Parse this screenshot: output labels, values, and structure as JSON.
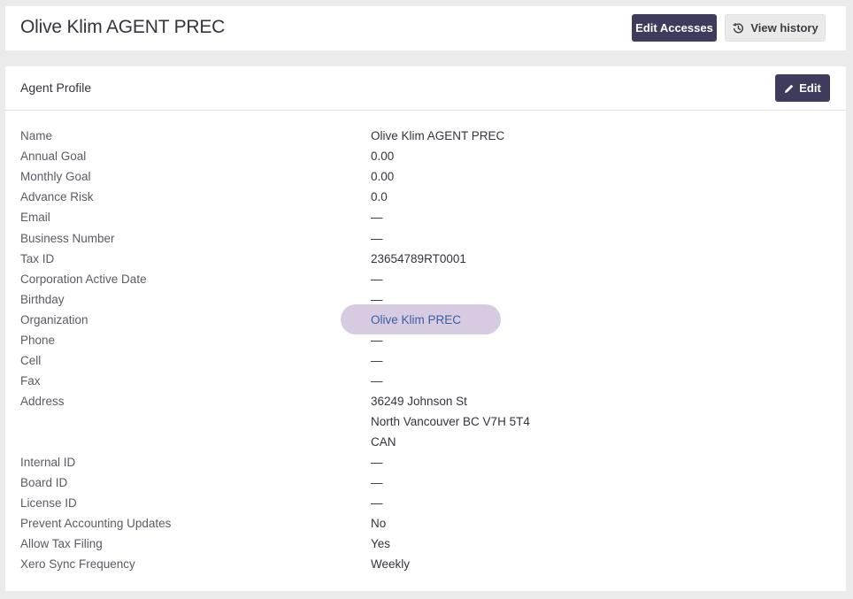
{
  "page": {
    "title": "Olive Klim AGENT PREC",
    "edit_accesses_label": "Edit Accesses",
    "view_history_label": "View history"
  },
  "profile": {
    "section_title": "Agent Profile",
    "edit_label": "Edit",
    "fields": {
      "name": {
        "label": "Name",
        "value": "Olive Klim AGENT PREC"
      },
      "annual_goal": {
        "label": "Annual Goal",
        "value": "0.00"
      },
      "monthly_goal": {
        "label": "Monthly Goal",
        "value": "0.00"
      },
      "advance_risk": {
        "label": "Advance Risk",
        "value": "0.0"
      },
      "email": {
        "label": "Email",
        "value": "—"
      },
      "business_number": {
        "label": "Business Number",
        "value": "—"
      },
      "tax_id": {
        "label": "Tax ID",
        "value": "23654789RT0001"
      },
      "corporation_active_date": {
        "label": "Corporation Active Date",
        "value": "—"
      },
      "birthday": {
        "label": "Birthday",
        "value": "—"
      },
      "organization": {
        "label": "Organization",
        "value": "Olive Klim PREC"
      },
      "phone": {
        "label": "Phone",
        "value": "—"
      },
      "cell": {
        "label": "Cell",
        "value": "—"
      },
      "fax": {
        "label": "Fax",
        "value": "—"
      },
      "address": {
        "label": "Address",
        "line1": "36249 Johnson St",
        "line2": "North Vancouver BC V7H 5T4",
        "line3": "CAN"
      },
      "internal_id": {
        "label": "Internal ID",
        "value": "—"
      },
      "board_id": {
        "label": "Board ID",
        "value": "—"
      },
      "license_id": {
        "label": "License ID",
        "value": "—"
      },
      "prevent_accounting_updates": {
        "label": "Prevent Accounting Updates",
        "value": "No"
      },
      "allow_tax_filing": {
        "label": "Allow Tax Filing",
        "value": "Yes"
      },
      "xero_sync_frequency": {
        "label": "Xero Sync Frequency",
        "value": "Weekly"
      }
    }
  },
  "colors": {
    "primary_button": "#3f3b5c",
    "link": "#3a5da3",
    "highlight": "#d7cbe1",
    "background": "#ebebeb"
  },
  "icons": {
    "view_history": "history-icon",
    "edit": "pencil-icon"
  }
}
